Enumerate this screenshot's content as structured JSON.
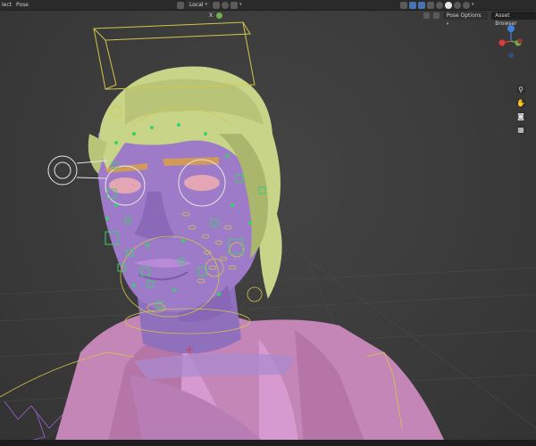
{
  "menu": {
    "select_partial": "lect",
    "pose": "Pose"
  },
  "toolbar": {
    "transform_orientation": "Local",
    "pose_options": "Pose Options",
    "asset_browser": "Asset Browser",
    "x_label": "X"
  },
  "gizmo": {
    "x_color": "#e03a3a",
    "y_color": "#6fb04a",
    "z_color": "#3d7fd9"
  },
  "nav_tools": [
    "zoom-icon",
    "hand-pan-icon",
    "camera-icon",
    "grid-icon"
  ],
  "colors": {
    "hair": "#c9d68a",
    "face": "#9a7ac7",
    "robe": "#cf8ac0",
    "rig_green": "#3ad06a",
    "rig_yellow": "#d4c64a"
  }
}
